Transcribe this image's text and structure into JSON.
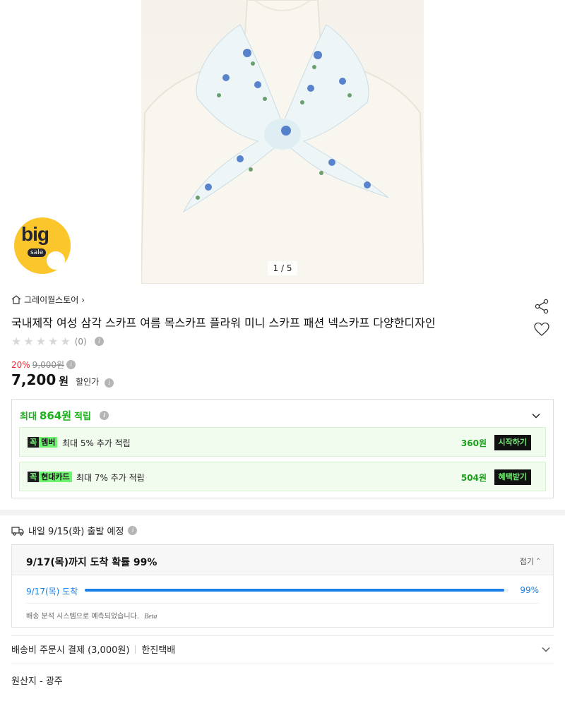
{
  "gallery": {
    "counter": "1 / 5"
  },
  "badge": {
    "big": "big",
    "sale": "sale"
  },
  "store": {
    "name": "그레이월스토어"
  },
  "product": {
    "title": "국내제작 여성 삼각 스카프 여름 목스카프 플라워 미니 스카프 패션 넥스카프 다양한디자인",
    "review_count": "(0)",
    "discount_rate": "20%",
    "original_price": "9,000원",
    "price": "7,200",
    "price_unit": "원",
    "price_label": "할인가"
  },
  "rewards": {
    "head_prefix": "최대",
    "head_amount": "864원",
    "head_suffix": "적립",
    "items": [
      {
        "tag_k": "꼭",
        "tag_v": "멤버",
        "text": "최대 5% 추가 적립",
        "amount": "360원",
        "button": "시작하기"
      },
      {
        "tag_k": "꼭",
        "tag_v": "현대카드",
        "text": "최대 7% 추가 적립",
        "amount": "504원",
        "button": "혜택받기"
      }
    ]
  },
  "shipping": {
    "departure": "내일 9/15(화) 출발 예정",
    "arrival_title": "9/17(목)까지 도착 확률 99%",
    "fold_label": "접기",
    "arrival_line": "9/17(목) 도착",
    "arrival_pct": "99%",
    "arrival_fraction": 0.99,
    "note": "배송 분석 시스템으로 예측되었습니다.",
    "beta": "Beta",
    "fee": "배송비 주문시 결제 (3,000원)",
    "courier": "한진택배",
    "origin": "원산지 - 광주"
  },
  "colors": {
    "accent_green": "#1bb11b",
    "neon": "#6ef36e",
    "sale_red": "#f5222d",
    "arrival_blue": "#1a7fe6",
    "badge_yellow": "#fbc62c"
  }
}
